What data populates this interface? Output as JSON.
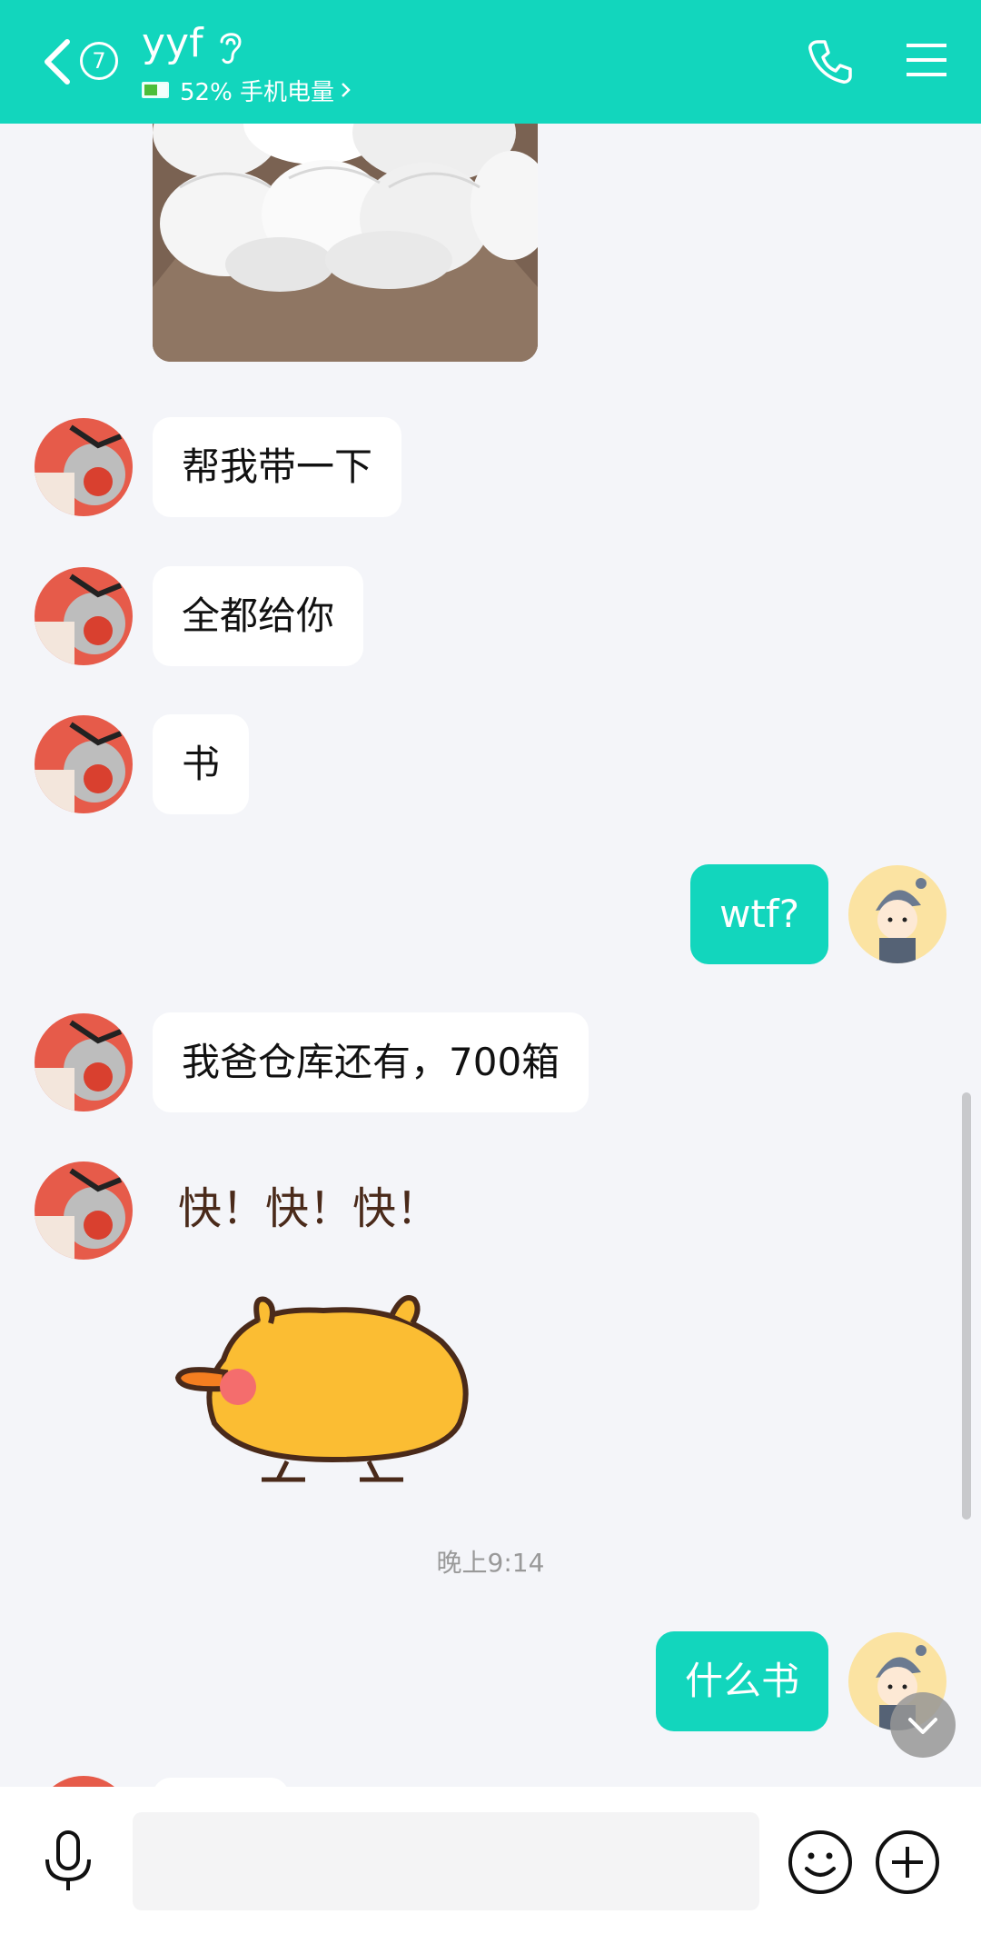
{
  "header": {
    "unread_count": "7",
    "contact_name": "yyf",
    "battery_text": "52% 手机电量",
    "battery_level": 0.52
  },
  "messages": [
    {
      "type": "image",
      "from": "friend",
      "content": "box of face masks photo"
    },
    {
      "type": "text",
      "from": "friend",
      "text": "帮我带一下"
    },
    {
      "type": "text",
      "from": "friend",
      "text": "全都给你"
    },
    {
      "type": "text",
      "from": "friend",
      "text": "书"
    },
    {
      "type": "text",
      "from": "me",
      "text": "wtf?"
    },
    {
      "type": "text",
      "from": "friend",
      "text": "我爸仓库还有，700箱"
    },
    {
      "type": "sticker",
      "from": "friend",
      "text": "快！快！快！"
    },
    {
      "type": "timestamp",
      "text": "晚上9:14"
    },
    {
      "type": "text",
      "from": "me",
      "text": "什么书"
    }
  ],
  "input": {
    "value": "",
    "placeholder": ""
  },
  "colors": {
    "accent": "#12d6bd",
    "background": "#f4f5f9",
    "bubble_in": "#ffffff"
  },
  "icons": [
    "back-icon",
    "ear-icon",
    "battery-icon",
    "phone-icon",
    "menu-icon",
    "scroll-down-icon",
    "mic-icon",
    "emoji-icon",
    "plus-icon"
  ]
}
